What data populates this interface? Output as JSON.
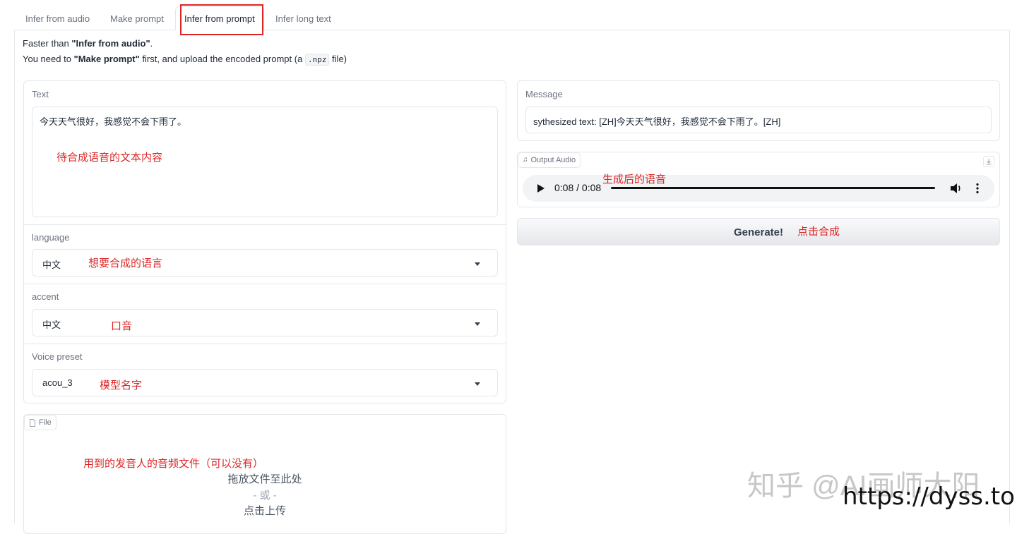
{
  "tabs": [
    {
      "label": "Infer from audio"
    },
    {
      "label": "Make prompt"
    },
    {
      "label": "Infer from prompt"
    },
    {
      "label": "Infer long text"
    }
  ],
  "description": {
    "line1_pre": "Faster than ",
    "line1_bold": "\"Infer from audio\"",
    "line1_post": ".",
    "line2_pre": "You need to ",
    "line2_bold": "\"Make prompt\"",
    "line2_mid": " first, and upload the encoded prompt (a ",
    "line2_code": ".npz",
    "line2_post": " file)"
  },
  "text_panel": {
    "label": "Text",
    "value": "今天天气很好，我感觉不会下雨了。",
    "annotation": "待合成语音的文本内容"
  },
  "language": {
    "label": "language",
    "value": "中文",
    "annotation": "想要合成的语言"
  },
  "accent": {
    "label": "accent",
    "value": "中文",
    "annotation": "口音"
  },
  "voice_preset": {
    "label": "Voice preset",
    "value": "acou_3",
    "annotation": "模型名字"
  },
  "file": {
    "label": "File",
    "annotation": "用到的发音人的音频文件（可以没有）",
    "drop_text": "拖放文件至此处",
    "or_text": "- 或 -",
    "click_text": "点击上传"
  },
  "message": {
    "label": "Message",
    "value": "sythesized text: [ZH]今天天气很好，我感觉不会下雨了。[ZH]"
  },
  "output_audio": {
    "label": "Output Audio",
    "time": "0:08 / 0:08",
    "annotation": "生成后的语音",
    "progress": 1.0
  },
  "generate": {
    "label": "Generate!",
    "annotation": "点击合成"
  },
  "watermark": {
    "text": "知乎 @AI画师大阳",
    "url": "https://dyss.top"
  },
  "colors": {
    "annotation": "#dc2626",
    "highlight_box": "#dc2626",
    "border": "#e5e7eb"
  }
}
